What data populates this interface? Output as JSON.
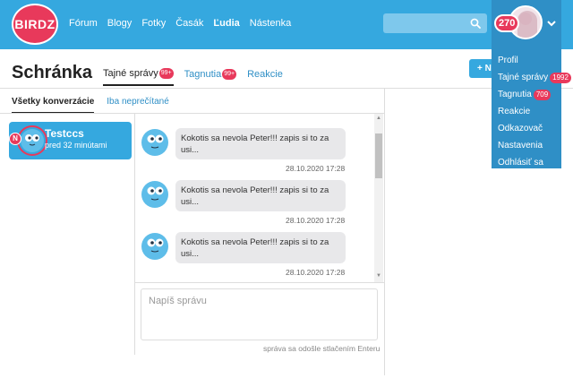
{
  "header": {
    "logo": "BIRDZ",
    "nav": [
      {
        "label": "Fórum",
        "active": false
      },
      {
        "label": "Blogy",
        "active": false
      },
      {
        "label": "Fotky",
        "active": false
      },
      {
        "label": "Časák",
        "active": false
      },
      {
        "label": "Ľudia",
        "active": true
      },
      {
        "label": "Nástenka",
        "active": false
      }
    ],
    "search": {
      "placeholder": ""
    },
    "user": {
      "count_badge": "270"
    }
  },
  "user_menu": {
    "items": [
      {
        "label": "Profil",
        "badge": ""
      },
      {
        "label": "Tajné správy",
        "badge": "1992"
      },
      {
        "label": "Tagnutia",
        "badge": "709"
      },
      {
        "label": "Reakcie",
        "badge": ""
      },
      {
        "label": "Odkazovač",
        "badge": ""
      },
      {
        "label": "Nastavenia",
        "badge": ""
      },
      {
        "label": "Odhlásiť sa",
        "badge": ""
      }
    ]
  },
  "page": {
    "title": "Schránka",
    "new_button": "+ N",
    "tabs": [
      {
        "label": "Tajné správy",
        "badge": "99+",
        "active": true
      },
      {
        "label": "Tagnutia",
        "badge": "99+",
        "active": false
      },
      {
        "label": "Reakcie",
        "badge": "",
        "active": false
      }
    ],
    "subtabs": [
      {
        "label": "Všetky konverzácie",
        "active": true
      },
      {
        "label": "Iba neprečítané",
        "active": false
      }
    ]
  },
  "conversations": [
    {
      "name": "Testccs",
      "time": "pred 32 minútami",
      "unread_marker": "N"
    }
  ],
  "messages": [
    {
      "text": "Kokotis sa nevola Peter!!! zapis si to za usi...",
      "date": "28.10.2020 17:28"
    },
    {
      "text": "Kokotis sa nevola Peter!!! zapis si to za usi...",
      "date": "28.10.2020 17:28"
    },
    {
      "text": "Kokotis sa nevola Peter!!! zapis si to za usi...",
      "date": "28.10.2020 17:28"
    }
  ],
  "composer": {
    "placeholder": "Napíš správu",
    "hint": "správa sa odošle stlačením Enteru"
  },
  "colors": {
    "header_blue": "#35a8df",
    "menu_blue": "#2f8fc6",
    "badge_red": "#e8395b",
    "bubble_gray": "#e8e8ea"
  }
}
